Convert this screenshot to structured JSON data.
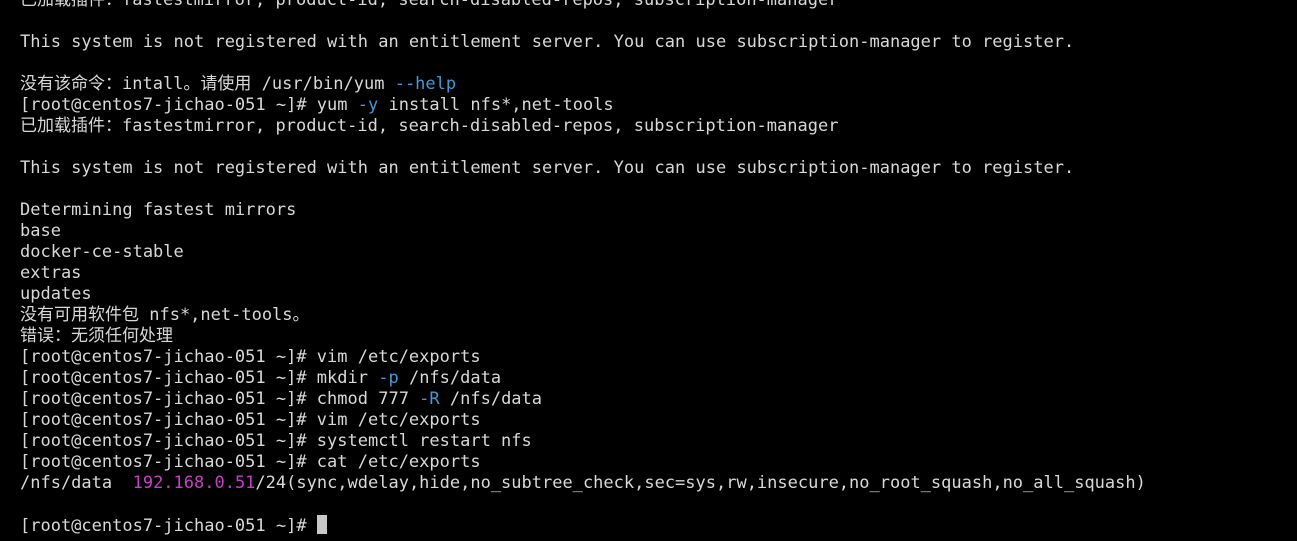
{
  "colors": {
    "background": "#000000",
    "default_text": "#d8d8d8",
    "option": "#3f9ad6",
    "ip_address": "#c83ec8",
    "cursor": "#c8c8c8"
  },
  "lines": [
    [
      {
        "text": "已加载插件：fastestmirror, product-id, search-disabled-repos, subscription-manager"
      }
    ],
    [],
    [
      {
        "text": "This system is not registered with an entitlement server. You can use subscription-manager to register."
      }
    ],
    [],
    [
      {
        "text": "没有该命令：intall。请使用 /usr/bin/yum "
      },
      {
        "text": "--help",
        "color": "#3f9ad6"
      }
    ],
    [
      {
        "text": "[root@centos7-jichao-051 ~]# yum "
      },
      {
        "text": "-y",
        "color": "#3f9ad6"
      },
      {
        "text": " install nfs*,net-tools"
      }
    ],
    [
      {
        "text": "已加载插件：fastestmirror, product-id, search-disabled-repos, subscription-manager"
      }
    ],
    [],
    [
      {
        "text": "This system is not registered with an entitlement server. You can use subscription-manager to register."
      }
    ],
    [],
    [
      {
        "text": "Determining fastest mirrors"
      }
    ],
    [
      {
        "text": "base"
      }
    ],
    [
      {
        "text": "docker-ce-stable"
      }
    ],
    [
      {
        "text": "extras"
      }
    ],
    [
      {
        "text": "updates"
      }
    ],
    [
      {
        "text": "没有可用软件包 nfs*,net-tools。"
      }
    ],
    [
      {
        "text": "错误：无须任何处理"
      }
    ],
    [
      {
        "text": "[root@centos7-jichao-051 ~]# vim /etc/exports"
      }
    ],
    [
      {
        "text": "[root@centos7-jichao-051 ~]# mkdir "
      },
      {
        "text": "-p",
        "color": "#3f9ad6"
      },
      {
        "text": " /nfs/data"
      }
    ],
    [
      {
        "text": "[root@centos7-jichao-051 ~]# chmod 777 "
      },
      {
        "text": "-R",
        "color": "#3f9ad6"
      },
      {
        "text": " /nfs/data"
      }
    ],
    [
      {
        "text": "[root@centos7-jichao-051 ~]# vim /etc/exports"
      }
    ],
    [
      {
        "text": "[root@centos7-jichao-051 ~]# systemctl restart nfs"
      }
    ],
    [
      {
        "text": "[root@centos7-jichao-051 ~]# cat /etc/exports"
      }
    ],
    [
      {
        "text": "/nfs/data  "
      },
      {
        "text": "192.168.0.51",
        "color": "#c83ec8"
      },
      {
        "text": "/24(sync,wdelay,hide,no_subtree_check,sec=sys,rw,insecure,no_root_squash,no_all_squash)"
      }
    ],
    [],
    [
      {
        "text": "[root@centos7-jichao-051 ~]# "
      },
      {
        "cursor": true
      }
    ]
  ]
}
